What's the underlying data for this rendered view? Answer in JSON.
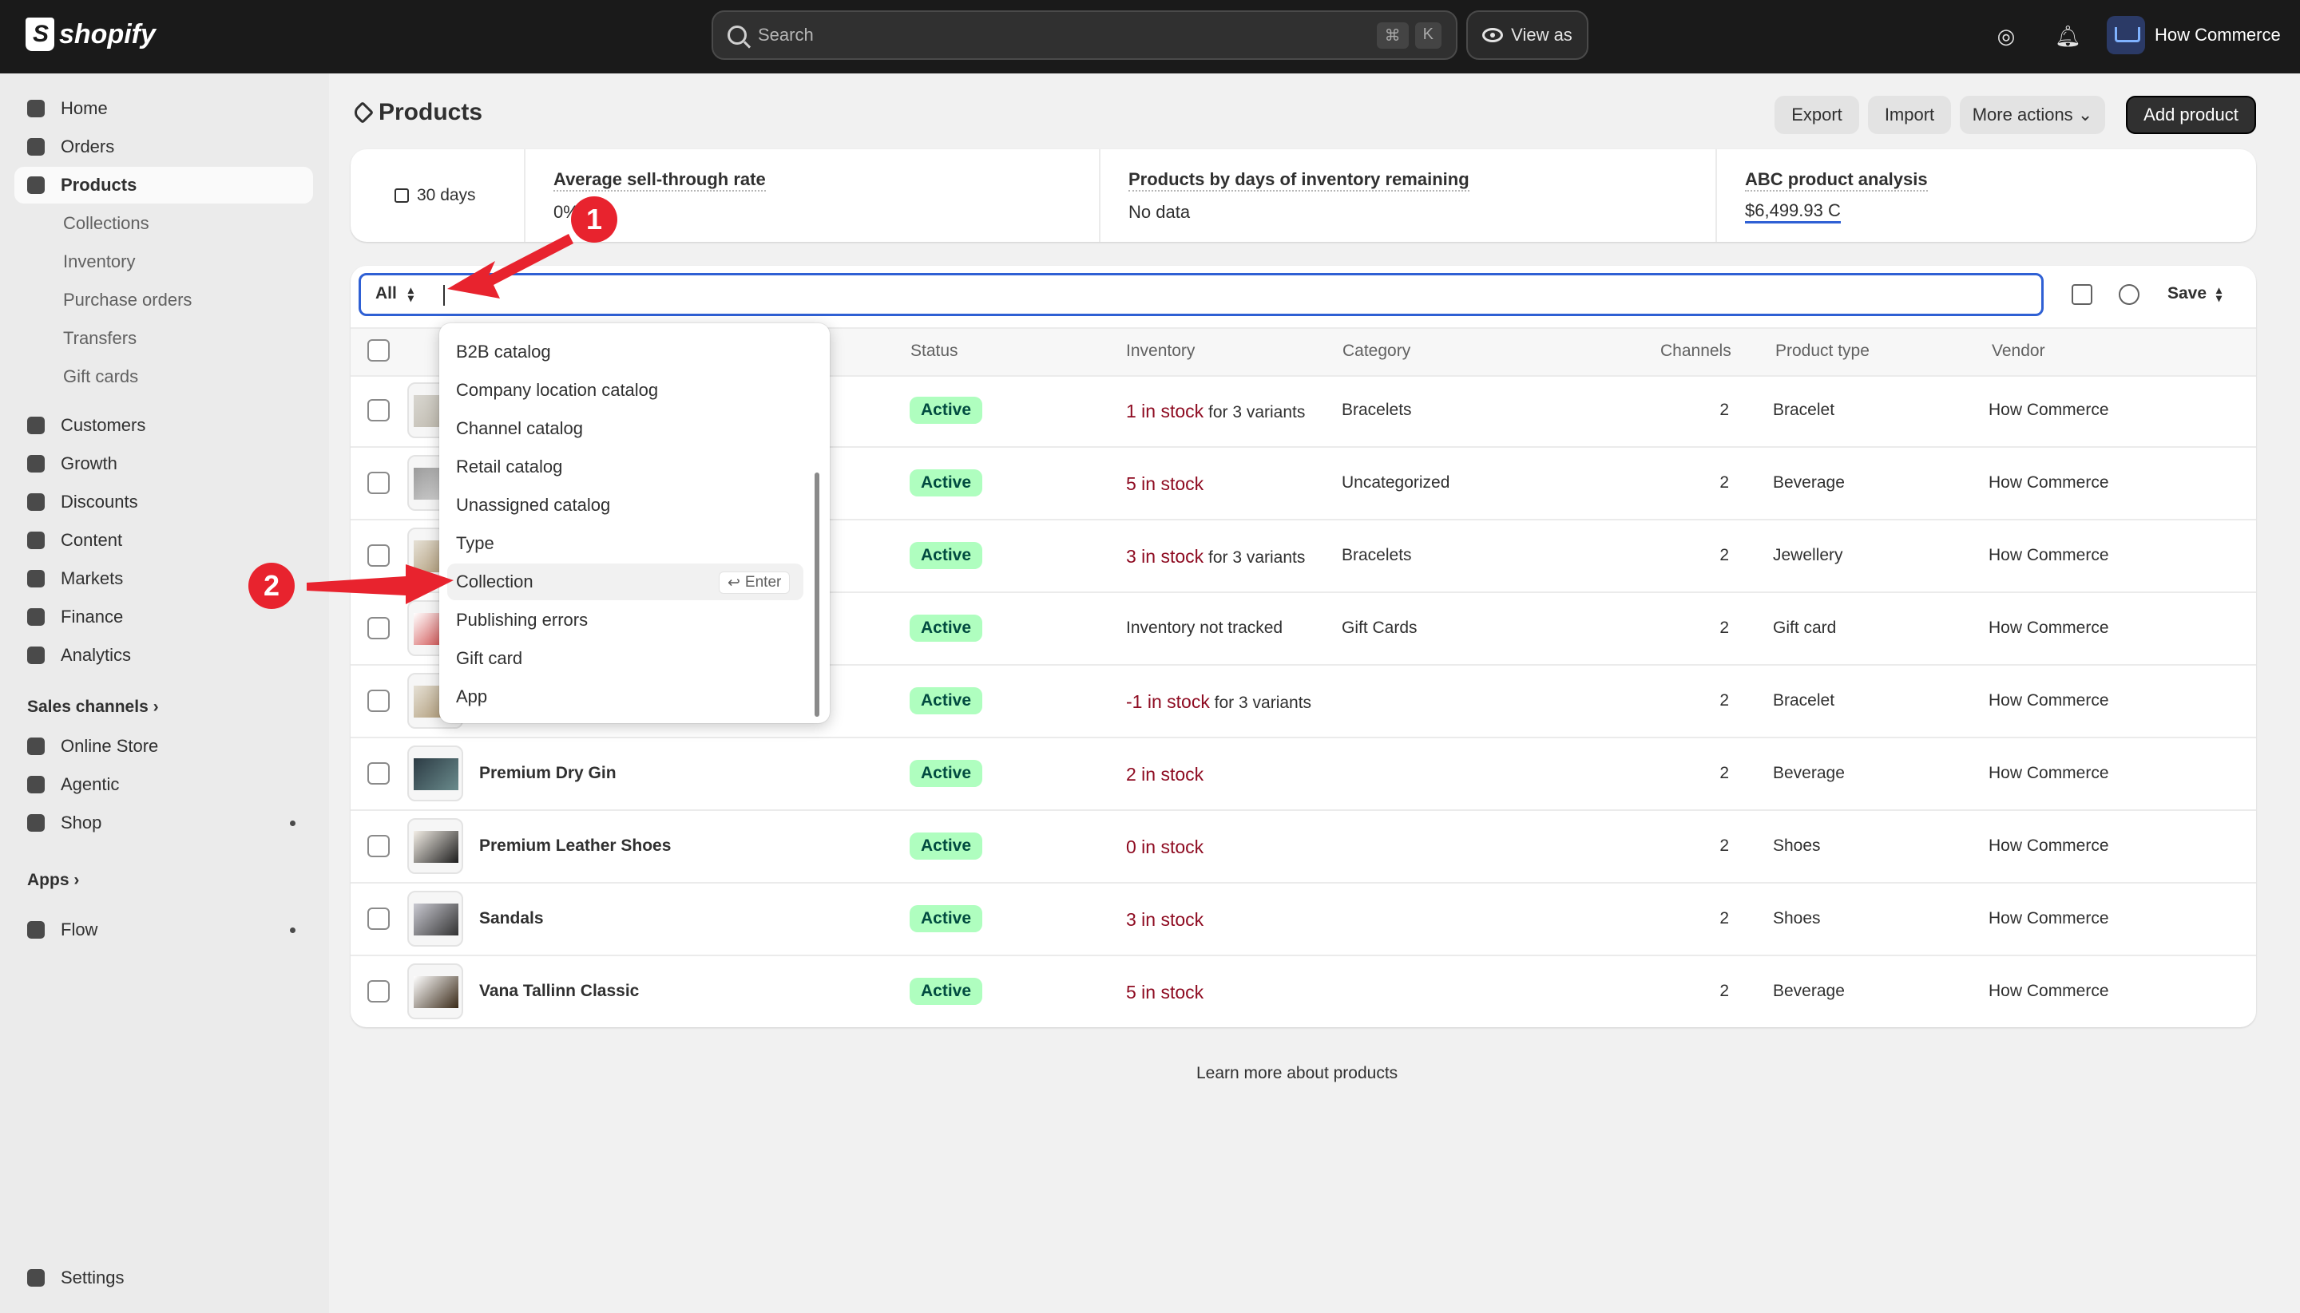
{
  "topbar": {
    "search_placeholder": "Search",
    "kbd": [
      "⌘",
      "K"
    ],
    "view_as": "View as",
    "store_name": "How Commerce"
  },
  "sidebar": {
    "items": [
      {
        "label": "Home",
        "icon": "home-icon"
      },
      {
        "label": "Orders",
        "icon": "orders-icon"
      },
      {
        "label": "Products",
        "icon": "tag-icon",
        "active": true
      },
      {
        "label": "Collections"
      },
      {
        "label": "Inventory"
      },
      {
        "label": "Purchase orders"
      },
      {
        "label": "Transfers"
      },
      {
        "label": "Gift cards"
      },
      {
        "label": "Customers",
        "icon": "person-icon"
      },
      {
        "label": "Growth",
        "icon": "growth-icon"
      },
      {
        "label": "Discounts",
        "icon": "discount-icon"
      },
      {
        "label": "Content",
        "icon": "content-icon"
      },
      {
        "label": "Markets",
        "icon": "globe-icon"
      },
      {
        "label": "Finance",
        "icon": "bank-icon"
      },
      {
        "label": "Analytics",
        "icon": "chart-icon"
      }
    ],
    "sales_channels_label": "Sales channels",
    "channels": [
      "Online Store",
      "Agentic",
      "Shop"
    ],
    "apps_label": "Apps",
    "apps": [
      "Flow"
    ],
    "settings": "Settings"
  },
  "page": {
    "title": "Products",
    "export": "Export",
    "import": "Import",
    "more_actions": "More actions",
    "add_product": "Add product"
  },
  "analytics": {
    "period": "30 days",
    "sell_through_label": "Average sell-through rate",
    "sell_through_value": "0%",
    "days_label": "Products by days of inventory remaining",
    "days_value": "No data",
    "abc_label": "ABC product analysis",
    "abc_value": "$6,499.93 C"
  },
  "filter": {
    "view": "All",
    "save": "Save"
  },
  "table": {
    "headers": [
      "Status",
      "Inventory",
      "Category",
      "Channels",
      "Product type",
      "Vendor"
    ],
    "rows": [
      {
        "name": "",
        "status": "Active",
        "inv_main": "1 in stock",
        "inv_suffix": " for 3 variants",
        "inv_red": true,
        "category": "Bracelets",
        "channels": "2",
        "type": "Bracelet",
        "vendor": "How Commerce"
      },
      {
        "name": "",
        "status": "Active",
        "inv_main": "5 in stock",
        "inv_suffix": "",
        "inv_red": true,
        "category": "Uncategorized",
        "channels": "2",
        "type": "Beverage",
        "vendor": "How Commerce"
      },
      {
        "name": "",
        "status": "Active",
        "inv_main": "3 in stock",
        "inv_suffix": " for 3 variants",
        "inv_red": true,
        "category": "Bracelets",
        "channels": "2",
        "type": "Jewellery",
        "vendor": "How Commerce"
      },
      {
        "name": "",
        "status": "Active",
        "inv_main": "Inventory not tracked",
        "inv_suffix": "",
        "inv_red": false,
        "category": "Gift Cards",
        "channels": "2",
        "type": "Gift card",
        "vendor": "How Commerce"
      },
      {
        "name": "",
        "status": "Active",
        "inv_main": "-1 in stock",
        "inv_suffix": " for 3 variants",
        "inv_red": true,
        "category": "",
        "channels": "2",
        "type": "Bracelet",
        "vendor": "How Commerce"
      },
      {
        "name": "Premium Dry Gin",
        "status": "Active",
        "inv_main": "2 in stock",
        "inv_suffix": "",
        "inv_red": true,
        "category": "",
        "channels": "2",
        "type": "Beverage",
        "vendor": "How Commerce"
      },
      {
        "name": "Premium Leather Shoes",
        "status": "Active",
        "inv_main": "0 in stock",
        "inv_suffix": "",
        "inv_red": true,
        "category": "",
        "channels": "2",
        "type": "Shoes",
        "vendor": "How Commerce"
      },
      {
        "name": "Sandals",
        "status": "Active",
        "inv_main": "3 in stock",
        "inv_suffix": "",
        "inv_red": true,
        "category": "",
        "channels": "2",
        "type": "Shoes",
        "vendor": "How Commerce"
      },
      {
        "name": "Vana Tallinn Classic",
        "status": "Active",
        "inv_main": "5 in stock",
        "inv_suffix": "",
        "inv_red": true,
        "category": "",
        "channels": "2",
        "type": "Beverage",
        "vendor": "How Commerce"
      }
    ],
    "footer_link": "Learn more about products"
  },
  "dropdown": {
    "items": [
      "B2B catalog",
      "Company location catalog",
      "Channel catalog",
      "Retail catalog",
      "Unassigned catalog",
      "Type",
      "Collection",
      "Publishing errors",
      "Gift card",
      "App"
    ],
    "highlighted": "Collection",
    "enter_hint": "Enter"
  },
  "annotations": {
    "marker1": "1",
    "marker2": "2",
    "color": "#e8232e"
  },
  "colors": {
    "accent_focus": "#2f60d4",
    "badge_bg": "#affebf",
    "stock_red": "#8e0b21"
  }
}
